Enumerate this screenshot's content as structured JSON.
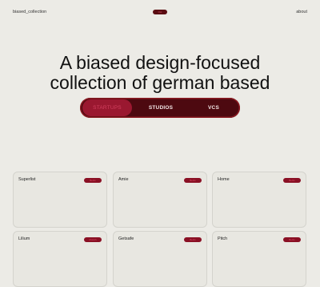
{
  "header": {
    "brand": "biased_collection",
    "center_badge": "Ost",
    "about": "about"
  },
  "hero": {
    "line1": "A biased design-focused",
    "line2": "collection of german based"
  },
  "tabs": [
    {
      "label": "STARTUPS",
      "active": true
    },
    {
      "label": "STUDIOS",
      "active": false
    },
    {
      "label": "VCS",
      "active": false
    }
  ],
  "cards": [
    {
      "name": "Superlist",
      "tag": "Berlin"
    },
    {
      "name": "Amie",
      "tag": "Berlin"
    },
    {
      "name": "Home",
      "tag": "Berlin"
    },
    {
      "name": "Lilium",
      "tag": "Munich"
    },
    {
      "name": "Getsafe",
      "tag": "Berlin"
    },
    {
      "name": "Pitch",
      "tag": "Berlin"
    }
  ],
  "colors": {
    "background": "#ecebe6",
    "accent_dark": "#4d0910",
    "accent": "#9a1830",
    "accent_text": "#e0506b"
  }
}
